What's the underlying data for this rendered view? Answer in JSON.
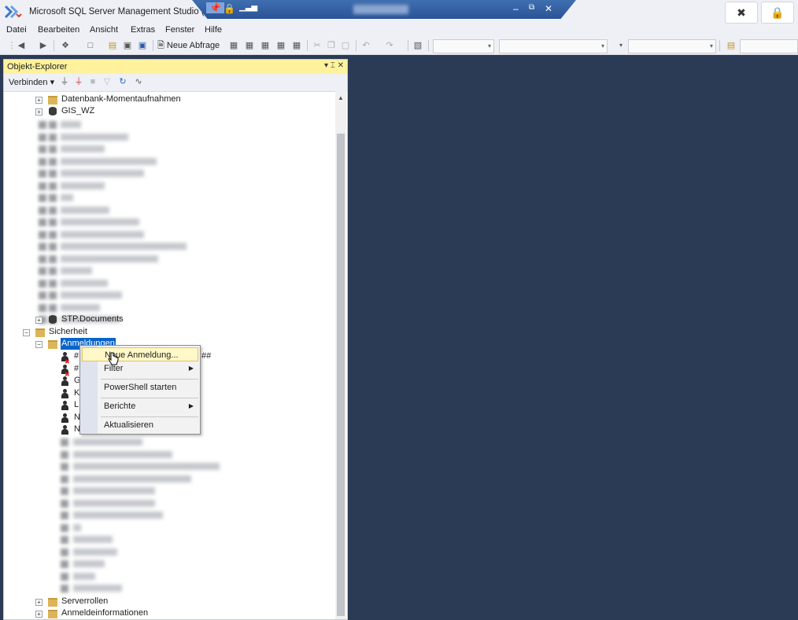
{
  "window": {
    "title": "Microsoft SQL Server Management Studio (Adm"
  },
  "rdp": {
    "icons": [
      "pin-icon",
      "lock-icon",
      "signal-icon"
    ],
    "controls": [
      "–",
      "⧉",
      "✕"
    ]
  },
  "menu": [
    "Datei",
    "Bearbeiten",
    "Ansicht",
    "Extras",
    "Fenster",
    "Hilfe"
  ],
  "toolbar": {
    "new_query": "Neue Abfrage"
  },
  "object_explorer": {
    "title": "Objekt-Explorer",
    "connect": "Verbinden ▾",
    "header_buttons": "▾  ⌶  ✕"
  },
  "tree": {
    "snapshots": "Datenbank-Momentaufnahmen",
    "gis": "GIS_WZ",
    "stp": "STP.Documents",
    "security": "Sicherheit",
    "logins": "Anmeldungen",
    "login_prefixes": [
      "#",
      "#",
      "G",
      "K",
      "LI",
      "N",
      "N"
    ],
    "login_suffix": "##",
    "server_roles": "Serverrollen",
    "credentials": "Anmeldeinformationen"
  },
  "context_menu": {
    "items": [
      "Neue Anmeldung...",
      "Filter",
      "PowerShell starten",
      "Berichte",
      "Aktualisieren"
    ]
  }
}
